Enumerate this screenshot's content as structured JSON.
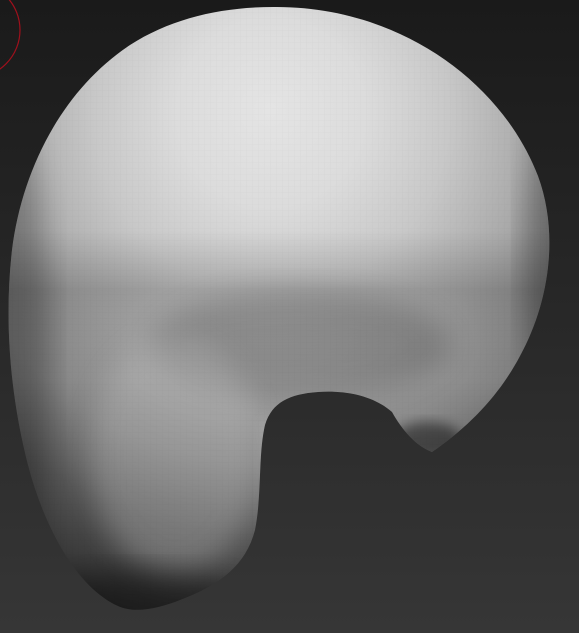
{
  "viewport": {
    "background_top": "#1a1a1a",
    "background_bottom": "#363636",
    "brush_cursor_color": "#a0101c",
    "mesh_highlight": "#e4e4e4",
    "mesh_mid": "#a9a9a9",
    "mesh_shadow": "#262626"
  }
}
